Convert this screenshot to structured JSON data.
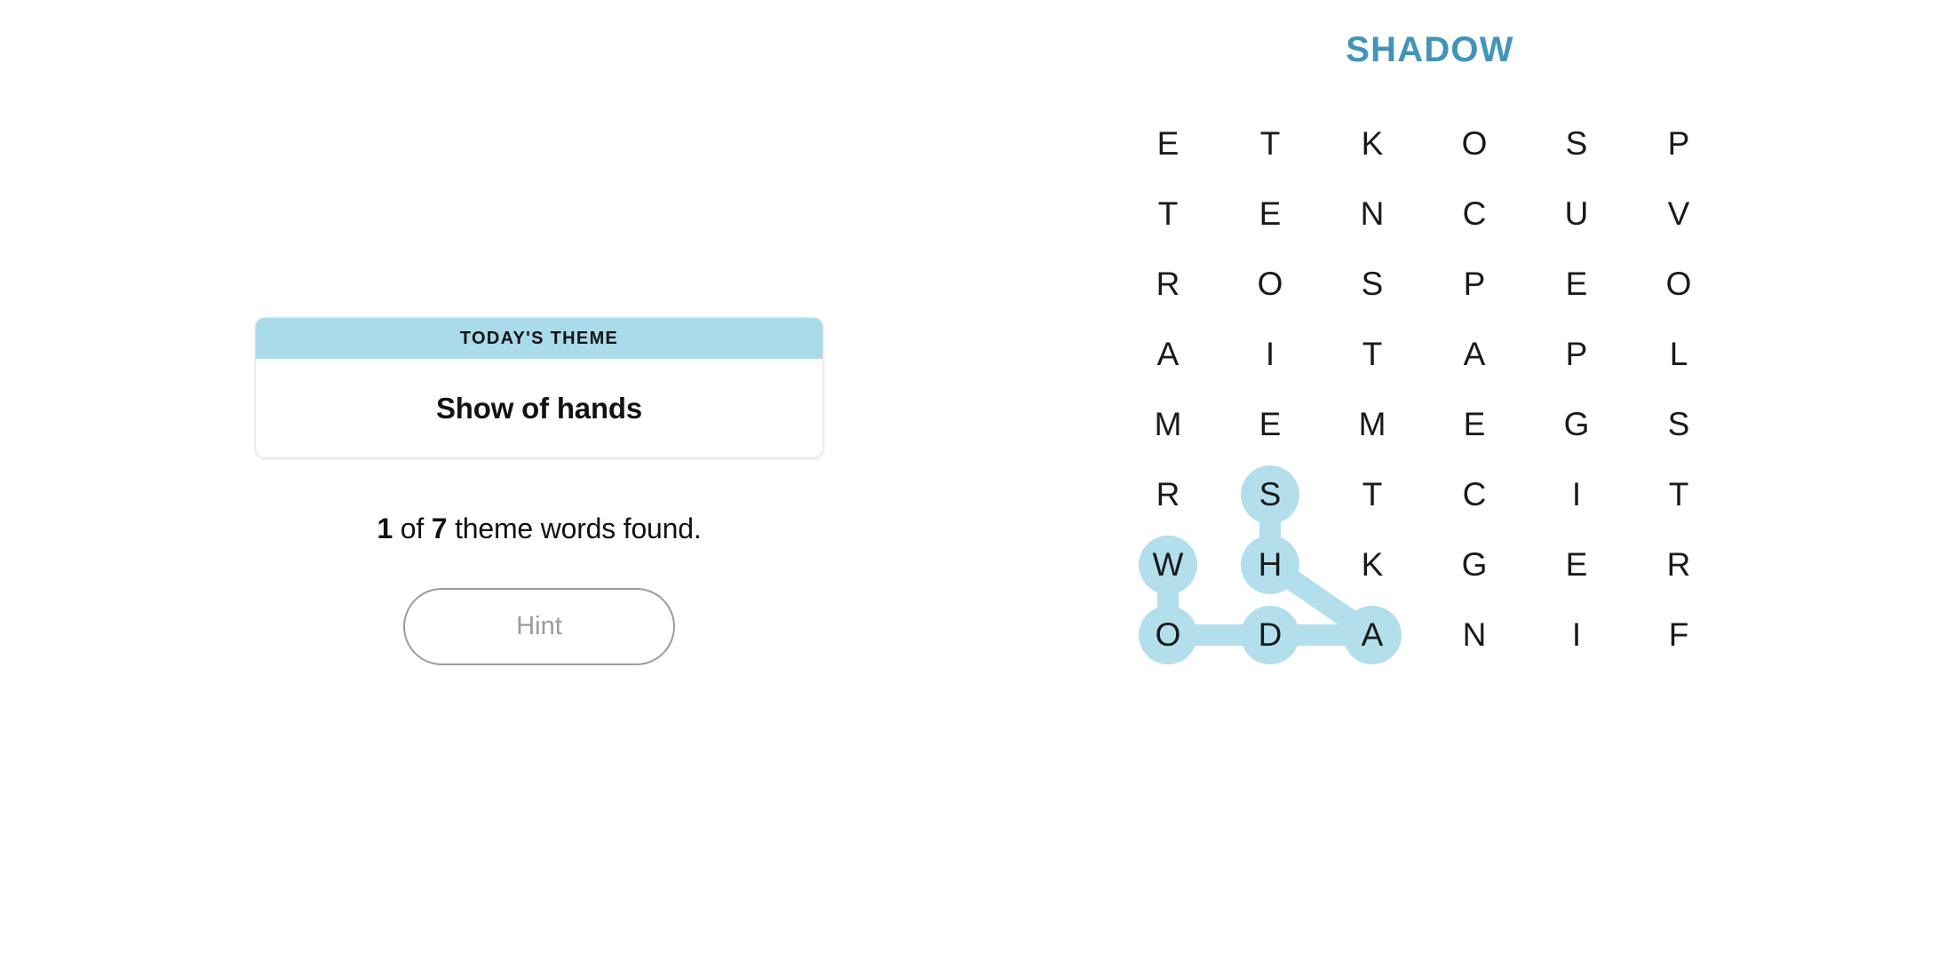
{
  "puzzle": {
    "title": "SHADOW",
    "title_color": "#4394ba"
  },
  "theme_card": {
    "header_label": "TODAY'S THEME",
    "header_color": "#aadbeb",
    "theme_text": "Show of hands"
  },
  "progress": {
    "found_count": "1",
    "of_word": "of",
    "total_count": "7",
    "suffix": "theme words found.",
    "full_text": "1 of 7 theme words found."
  },
  "hint": {
    "label": "Hint",
    "disabled": true
  },
  "grid": {
    "rows": 8,
    "cols": 6,
    "highlight_color": "#b3dfed",
    "letters": [
      [
        "E",
        "T",
        "K",
        "O",
        "S",
        "P"
      ],
      [
        "T",
        "E",
        "N",
        "C",
        "U",
        "V"
      ],
      [
        "R",
        "O",
        "S",
        "P",
        "E",
        "O"
      ],
      [
        "A",
        "I",
        "T",
        "A",
        "P",
        "L"
      ],
      [
        "M",
        "E",
        "M",
        "E",
        "G",
        "S"
      ],
      [
        "R",
        "S",
        "T",
        "C",
        "I",
        "T"
      ],
      [
        "W",
        "H",
        "K",
        "G",
        "E",
        "R"
      ],
      [
        "O",
        "D",
        "A",
        "N",
        "I",
        "F"
      ]
    ],
    "found_words": [
      {
        "word": "SHADOW",
        "path": [
          {
            "row": 5,
            "col": 1,
            "letter": "S"
          },
          {
            "row": 6,
            "col": 1,
            "letter": "H"
          },
          {
            "row": 7,
            "col": 2,
            "letter": "A"
          },
          {
            "row": 7,
            "col": 1,
            "letter": "D"
          },
          {
            "row": 7,
            "col": 0,
            "letter": "O"
          },
          {
            "row": 6,
            "col": 0,
            "letter": "W"
          }
        ]
      }
    ]
  }
}
